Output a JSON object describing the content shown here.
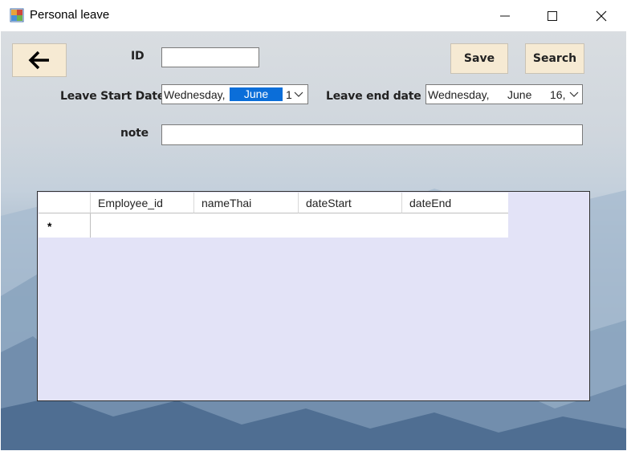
{
  "window": {
    "title": "Personal leave",
    "controls": {
      "minimize": "minimize-icon",
      "maximize": "maximize-icon",
      "close": "close-icon"
    }
  },
  "form": {
    "back_icon": "arrow-left-icon",
    "id_label": "ID",
    "id_value": "",
    "leave_start_label": "Leave Start Date",
    "leave_start_value": {
      "weekday": "Wednesday,",
      "month_selected": "June",
      "day": "1"
    },
    "leave_end_label": "Leave end date",
    "leave_end_value": {
      "weekday": "Wednesday,",
      "month": "June",
      "day": "16,"
    },
    "note_label": "note",
    "note_value": "",
    "save_label": "Save",
    "search_label": "Search"
  },
  "grid": {
    "columns": [
      "Employee_id",
      "nameThai",
      "dateStart",
      "dateEnd"
    ],
    "new_row_marker": "*",
    "rows": []
  },
  "colors": {
    "button_bg": "#f6ead3",
    "grid_bg": "#e3e3f7",
    "selection": "#0b6ed9"
  }
}
